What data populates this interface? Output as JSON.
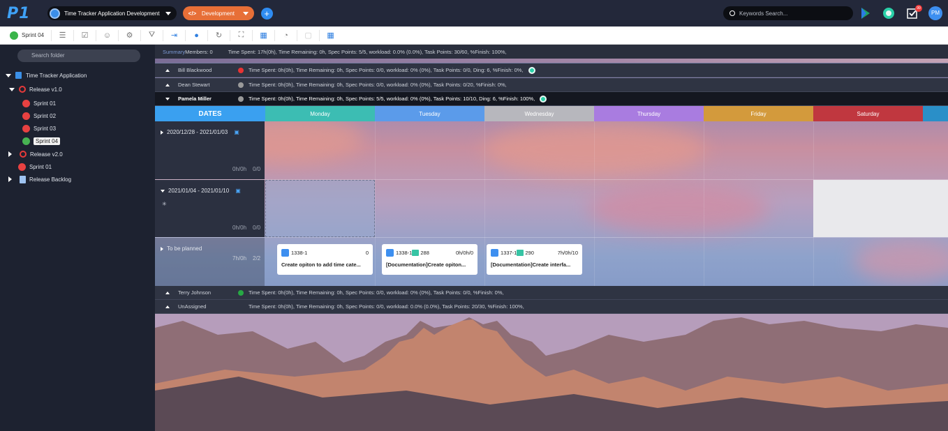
{
  "header": {
    "logo": "P1",
    "project": "Time Tracker Application Development",
    "branch": "Development",
    "search_placeholder": "Keywords Search...",
    "notifications_badge": "99",
    "avatar_initials": "PM"
  },
  "toolbar": {
    "sprint_label": "Sprint 04"
  },
  "sidebar": {
    "search_placeholder": "Search folder",
    "tree": {
      "root": "Time Tracker Application",
      "release1": "Release v1.0",
      "sprints": [
        "Sprint 01",
        "Sprint 02",
        "Sprint 03",
        "Sprint 04"
      ],
      "release2": "Release v2.0",
      "release2_sprint": "Sprint 01",
      "backlog": "Release Backlog"
    }
  },
  "summary": {
    "label": "Summary",
    "members": "Members: 0",
    "stats": "Time Spent: 17h(0h),   Time Remaining: 0h,   Spec Points: 5/5,   workload: 0.0% (0.0%),   Task Points: 30/60,   %Finish: 100%,"
  },
  "members": [
    {
      "name": "Bill Blackwood",
      "status_color": "#e83333",
      "stats": "Time Spent: 0h(0h),   Time Remaining: 0h,   Spec Points: 0/0,   workload: 0% (0%),   Task Points: 0/0,   Ding: 6,   %Finish: 0%,"
    },
    {
      "name": "Dean Stewart",
      "status_color": "#9a9a9a",
      "stats": "Time Spent: 0h(0h),   Time Remaining: 0h,   Spec Points: 0/0,   workload: 0% (0%),   Task Points: 0/20,   %Finish: 0%,"
    },
    {
      "name": "Pamela Miller",
      "status_color": "#9a9a9a",
      "stats": "Time Spent: 0h(0h),   Time Remaining: 0h,   Spec Points: 5/5,   workload: 0% (0%),   Task Points: 10/10,   Ding: 6,   %Finish: 100%,"
    },
    {
      "name": "Terry Johnson",
      "status_color": "#27a844",
      "stats": "Time Spent: 0h(0h),   Time Remaining: 0h,   Spec Points: 0/0,   workload: 0% (0%),   Task Points: 0/0,   %Finish: 0%,"
    },
    {
      "name": "UnAssigned",
      "status_color": "",
      "stats": "Time Spent: 0h(0h),   Time Remaining: 0h,   Spec Points: 0/0,   workload: 0.0% (0.0%),   Task Points: 20/30,   %Finish: 100%,"
    }
  ],
  "calendar": {
    "dates_header": "DATES",
    "days": [
      {
        "label": "Monday",
        "color": "#3cbdb3"
      },
      {
        "label": "Tuesday",
        "color": "#5b9bea"
      },
      {
        "label": "Wednesday",
        "color": "#b7b7bd"
      },
      {
        "label": "Thursday",
        "color": "#a97ce0"
      },
      {
        "label": "Friday",
        "color": "#d39a3c"
      },
      {
        "label": "Saturday",
        "color": "#c0373f"
      }
    ],
    "weeks": [
      {
        "range": "2020/12/28 - 2021/01/03",
        "totals": "0h/0h",
        "count": "0/0"
      },
      {
        "range": "2021/01/04 - 2021/01/10",
        "totals": "0h/0h",
        "count": "0/0"
      }
    ],
    "to_be_planned": {
      "label": "To be planned",
      "totals": "7h/0h",
      "count": "2/2"
    }
  },
  "cards": [
    {
      "id": "1338-1",
      "doc": "",
      "value": "0",
      "title": "Create opiton to add time cate..."
    },
    {
      "id": "1338-1",
      "doc": "288",
      "value": "0h/0h/0",
      "title": "[Documentation]Create opiton..."
    },
    {
      "id": "1337-1",
      "doc": "290",
      "value": "7h/0h/10",
      "title": "[Documentation]Create interfa..."
    }
  ]
}
